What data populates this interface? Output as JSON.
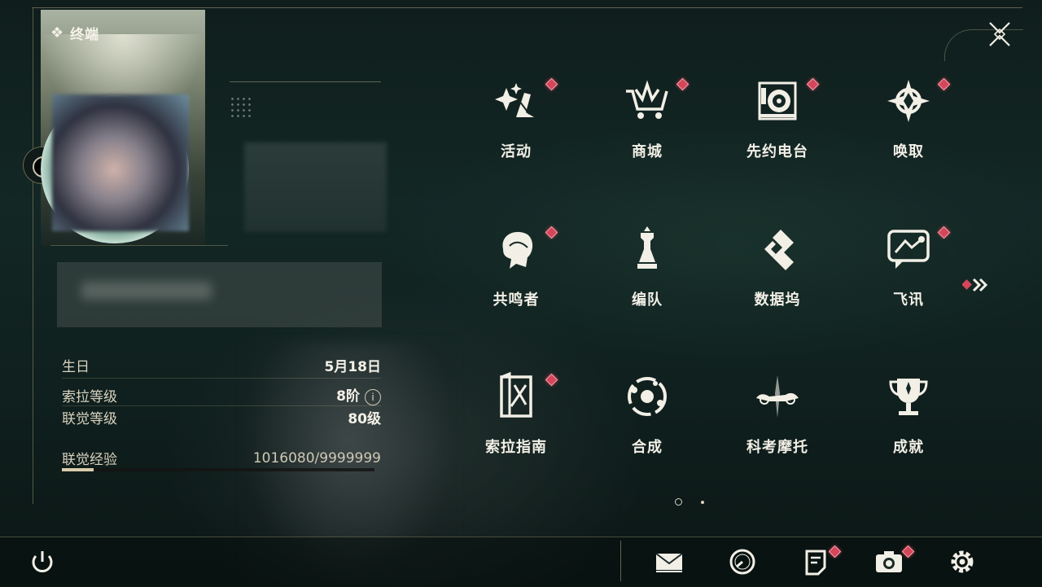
{
  "header": {
    "title": "终端"
  },
  "profile": {
    "stats": [
      {
        "label": "生日",
        "value": "5月18日"
      },
      {
        "label": "索拉等级",
        "value": "8阶",
        "info_icon": "info-icon"
      },
      {
        "label": "联觉等级",
        "value": "80级"
      }
    ],
    "xp": {
      "label": "联觉经验",
      "value": "1016080/9999999",
      "progress": 0.1016
    }
  },
  "menu": {
    "items": [
      {
        "label": "活动",
        "icon": "sparkle-icon",
        "badge": true
      },
      {
        "label": "商城",
        "icon": "shop-cart-icon",
        "badge": true
      },
      {
        "label": "先约电台",
        "icon": "radio-icon",
        "badge": true
      },
      {
        "label": "唤取",
        "icon": "summon-star-icon",
        "badge": true
      },
      {
        "label": "共鸣者",
        "icon": "resonator-portrait-icon",
        "badge": true
      },
      {
        "label": "编队",
        "icon": "chess-team-icon",
        "badge": false
      },
      {
        "label": "数据坞",
        "icon": "data-dock-icon",
        "badge": false
      },
      {
        "label": "飞讯",
        "icon": "message-bubble-icon",
        "badge": true
      },
      {
        "label": "索拉指南",
        "icon": "guide-book-icon",
        "badge": true
      },
      {
        "label": "合成",
        "icon": "synthesis-icon",
        "badge": false
      },
      {
        "label": "科考摩托",
        "icon": "motorcycle-icon",
        "badge": false
      },
      {
        "label": "成就",
        "icon": "trophy-icon",
        "badge": false
      }
    ],
    "page": 1,
    "pages": 2
  },
  "bottom_bar": {
    "buttons": [
      {
        "name": "power-icon",
        "badge": false
      },
      {
        "name": "mail-icon",
        "badge": false
      },
      {
        "name": "clock-icon",
        "badge": false
      },
      {
        "name": "notice-icon",
        "badge": true
      },
      {
        "name": "camera-icon",
        "badge": true
      },
      {
        "name": "settings-gear-icon",
        "badge": false
      }
    ]
  },
  "colors": {
    "badge": "#d5465a",
    "accent": "#d9ccaa",
    "text": "#f2efe6"
  }
}
